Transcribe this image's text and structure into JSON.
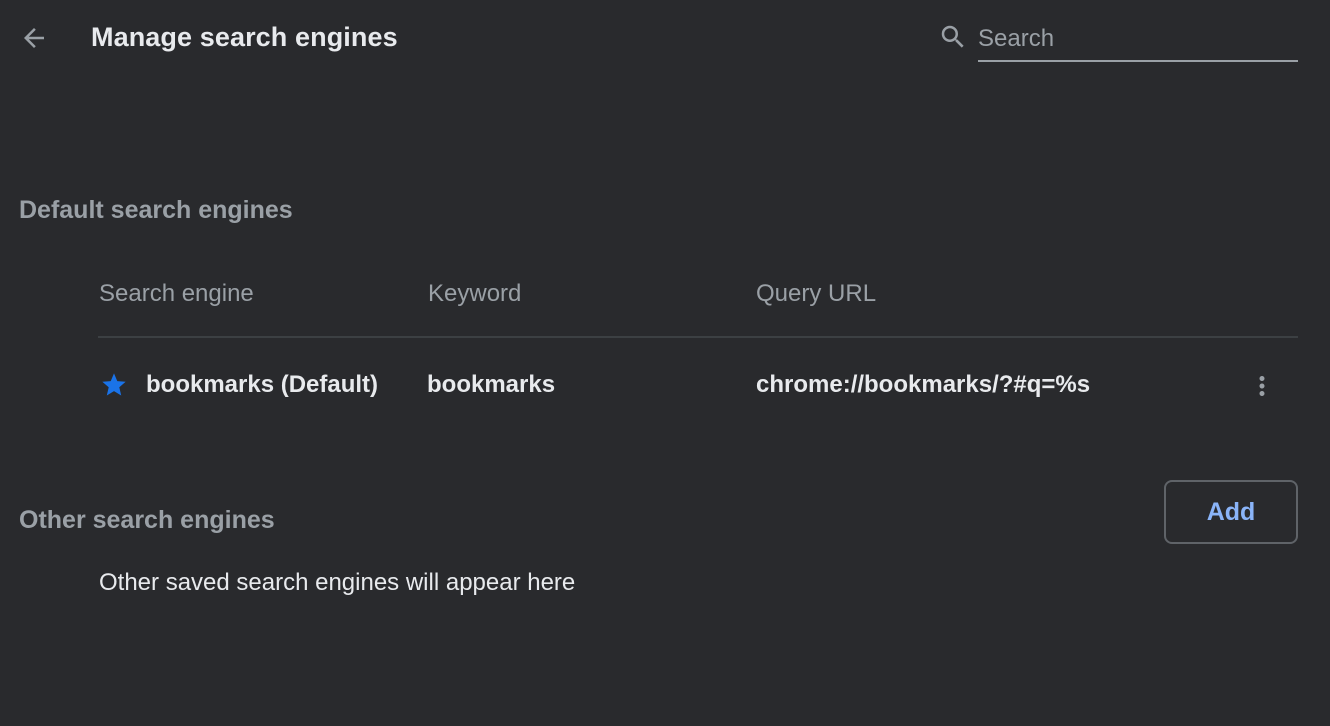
{
  "header": {
    "title": "Manage search engines",
    "back_icon": "arrow-back-icon",
    "search": {
      "placeholder": "Search",
      "value": "",
      "icon": "search-icon"
    }
  },
  "default_section": {
    "heading": "Default search engines",
    "columns": [
      "Search engine",
      "Keyword",
      "Query URL"
    ],
    "rows": [
      {
        "icon": "star-icon",
        "name": "bookmarks (Default)",
        "keyword": "bookmarks",
        "query_url": "chrome://bookmarks/?#q=%s",
        "menu_icon": "more-vert-icon"
      }
    ]
  },
  "other_section": {
    "heading": "Other search engines",
    "add_label": "Add",
    "empty_message": "Other saved search engines will appear here"
  },
  "colors": {
    "background": "#292a2d",
    "primary_text": "#e8eaed",
    "secondary_text": "#9aa0a6",
    "accent": "#8ab4f8",
    "star": "#1a73e8",
    "divider": "#3c4043"
  }
}
